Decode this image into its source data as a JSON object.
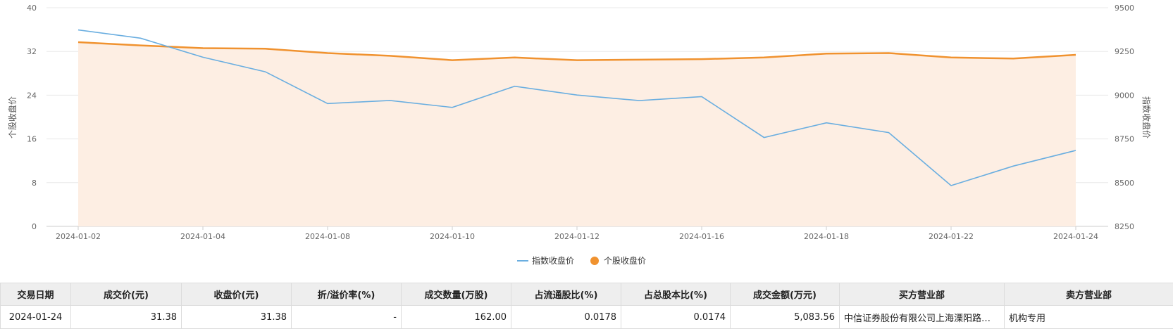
{
  "chart_data": {
    "type": "line",
    "x": [
      "2024-01-02",
      "2024-01-03",
      "2024-01-04",
      "2024-01-05",
      "2024-01-08",
      "2024-01-09",
      "2024-01-10",
      "2024-01-11",
      "2024-01-12",
      "2024-01-15",
      "2024-01-16",
      "2024-01-17",
      "2024-01-18",
      "2024-01-19",
      "2024-01-22",
      "2024-01-23",
      "2024-01-24"
    ],
    "x_tick_labels": [
      "2024-01-02",
      "2024-01-04",
      "2024-01-08",
      "2024-01-10",
      "2024-01-12",
      "2024-01-16",
      "2024-01-18",
      "2024-01-22",
      "2024-01-24"
    ],
    "y_left": {
      "label": "个股收盘价",
      "range": [
        0,
        40
      ],
      "ticks": [
        "0",
        "8",
        "16",
        "24",
        "32",
        "40"
      ]
    },
    "y_right": {
      "label": "指数收盘价",
      "range": [
        8250,
        9500
      ],
      "ticks": [
        "8250",
        "8500",
        "8750",
        "9000",
        "9250",
        "9500"
      ]
    },
    "series": [
      {
        "name": "指数收盘价",
        "axis": "right",
        "color": "#6aaee0",
        "style": "line",
        "values": [
          9373,
          9326,
          9217,
          9134,
          8952,
          8970,
          8930,
          9051,
          9001,
          8969,
          8992,
          8758,
          8842,
          8786,
          8483,
          8595,
          8684
        ]
      },
      {
        "name": "个股收盘价",
        "axis": "left",
        "color": "#f0922f",
        "fill": "#fdeee3",
        "style": "area",
        "values": [
          33.7,
          33.1,
          32.6,
          32.5,
          31.7,
          31.2,
          30.4,
          30.9,
          30.4,
          30.5,
          30.6,
          30.9,
          31.6,
          31.7,
          30.9,
          30.7,
          31.38
        ]
      }
    ],
    "grid": true,
    "legend_position": "bottom-center"
  },
  "table": {
    "headers": [
      "交易日期",
      "成交价(元)",
      "收盘价(元)",
      "折/溢价率(%)",
      "成交数量(万股)",
      "占流通股比(%)",
      "占总股本比(%)",
      "成交金额(万元)",
      "买方营业部",
      "卖方营业部"
    ],
    "rows": [
      [
        "2024-01-24",
        "31.38",
        "31.38",
        "-",
        "162.00",
        "0.0178",
        "0.0174",
        "5,083.56",
        "中信证券股份有限公司上海溧阳路…",
        "机构专用"
      ]
    ]
  }
}
